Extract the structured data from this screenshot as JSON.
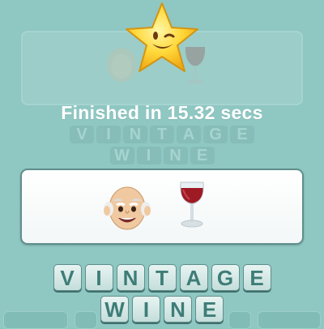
{
  "result": {
    "finished_text": "Finished in 15.32 secs",
    "time_secs": 15.32
  },
  "clue": {
    "emojis": [
      "old-man-emoji",
      "wine-glass-emoji"
    ]
  },
  "answer": {
    "word1": [
      "V",
      "I",
      "N",
      "T",
      "A",
      "G",
      "E"
    ],
    "word2": [
      "W",
      "I",
      "N",
      "E"
    ]
  },
  "colors": {
    "background": "#8fc7c2",
    "tile_text": "#3e7d77",
    "star": "#ffd23a"
  }
}
